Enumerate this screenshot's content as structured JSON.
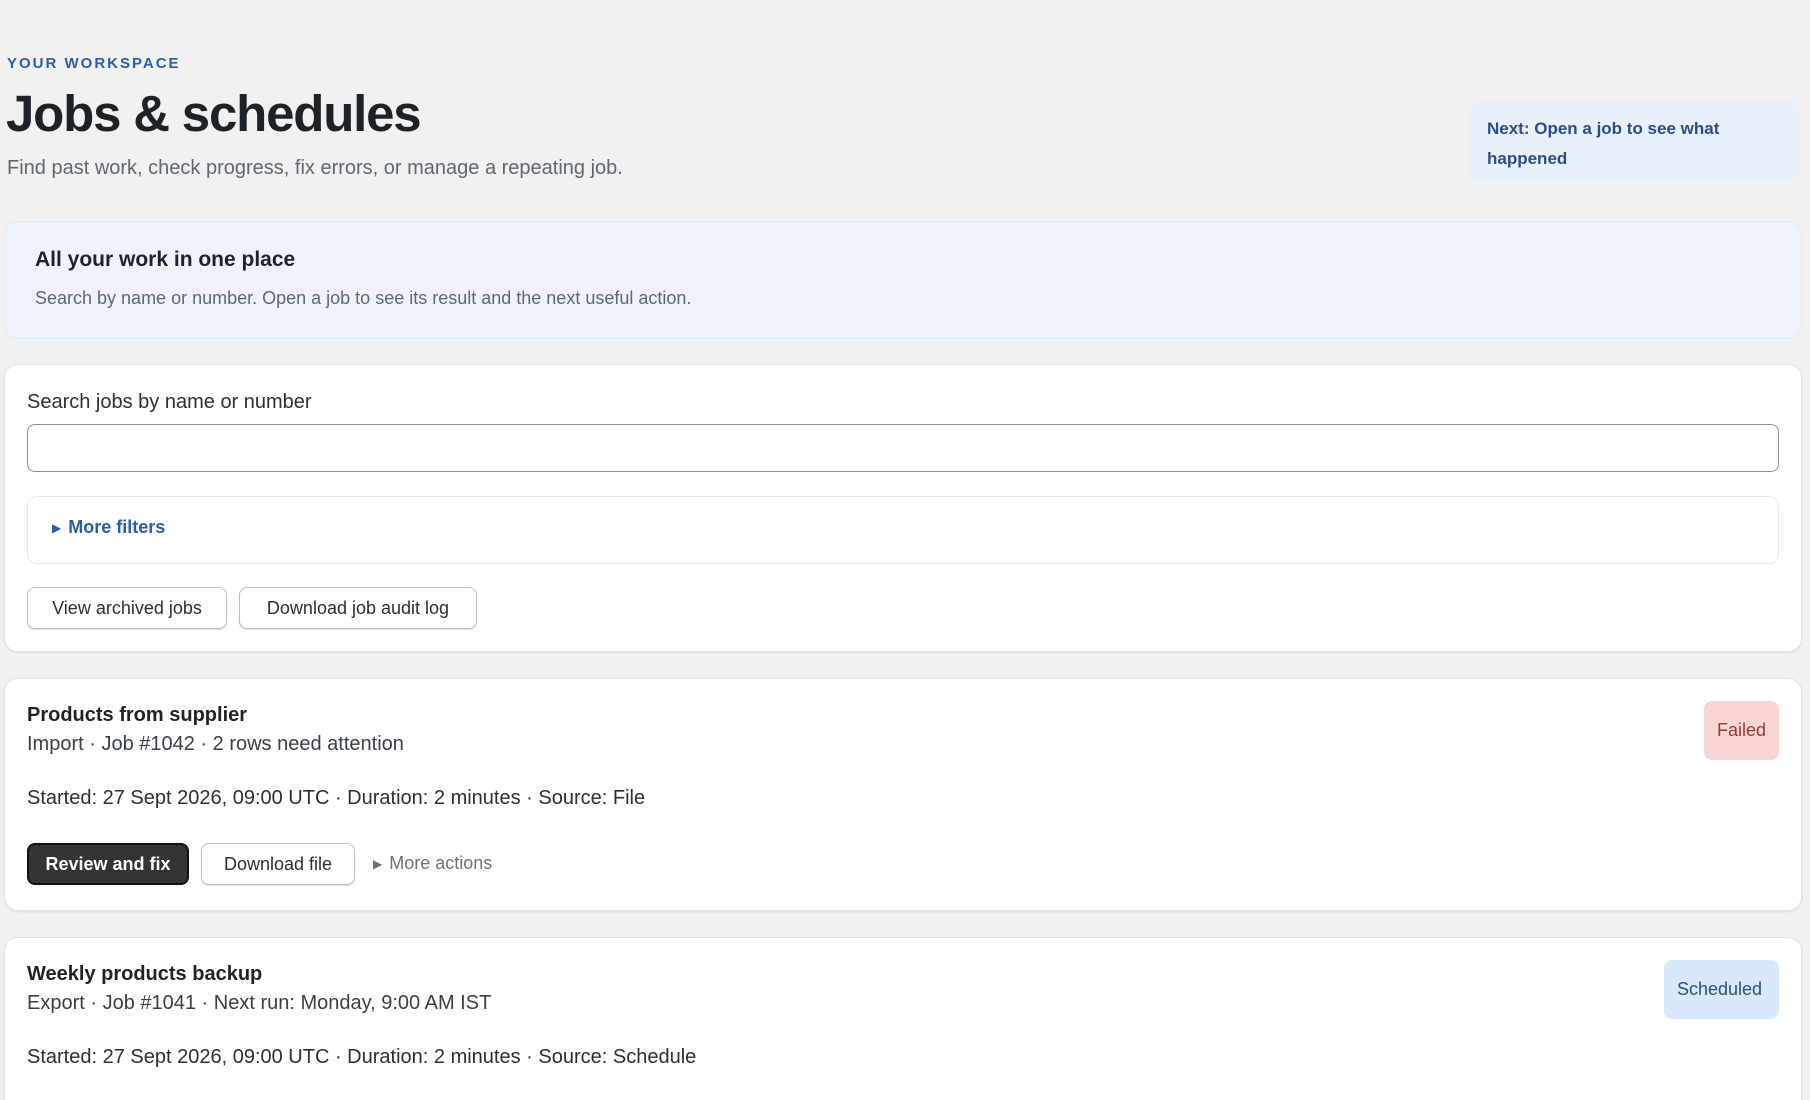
{
  "header": {
    "eyebrow": "YOUR WORKSPACE",
    "title": "Jobs & schedules",
    "subtitle": "Find past work, check progress, fix errors, or manage a repeating job.",
    "next_hint": "Next: Open a job to see what happened"
  },
  "intro": {
    "title": "All your work in one place",
    "text": "Search by name or number. Open a job to see its result and the next useful action."
  },
  "search": {
    "label": "Search jobs by name or number",
    "value": "",
    "filters_label": "More filters",
    "archived_label": "View archived jobs",
    "audit_label": "Download job audit log"
  },
  "jobs": [
    {
      "title": "Products from supplier",
      "meta": "Import · Job #1042 · 2 rows need attention",
      "started": "Started: 27 Sept 2026, 09:00 UTC · Duration: 2 minutes · Source: File",
      "status": "Failed",
      "primary_action": "Review and fix",
      "secondary_action": "Download file",
      "more_actions": "More actions"
    },
    {
      "title": "Weekly products backup",
      "meta": "Export · Job #1041 · Next run: Monday, 9:00 AM IST",
      "started": "Started: 27 Sept 2026, 09:00 UTC · Duration: 2 minutes · Source: Schedule",
      "status": "Scheduled"
    }
  ],
  "colors": {
    "accent": "#2a5ea8",
    "failed_bg": "#f9d6d4",
    "scheduled_bg": "#d7e9fb",
    "primary_button": "#343434"
  }
}
